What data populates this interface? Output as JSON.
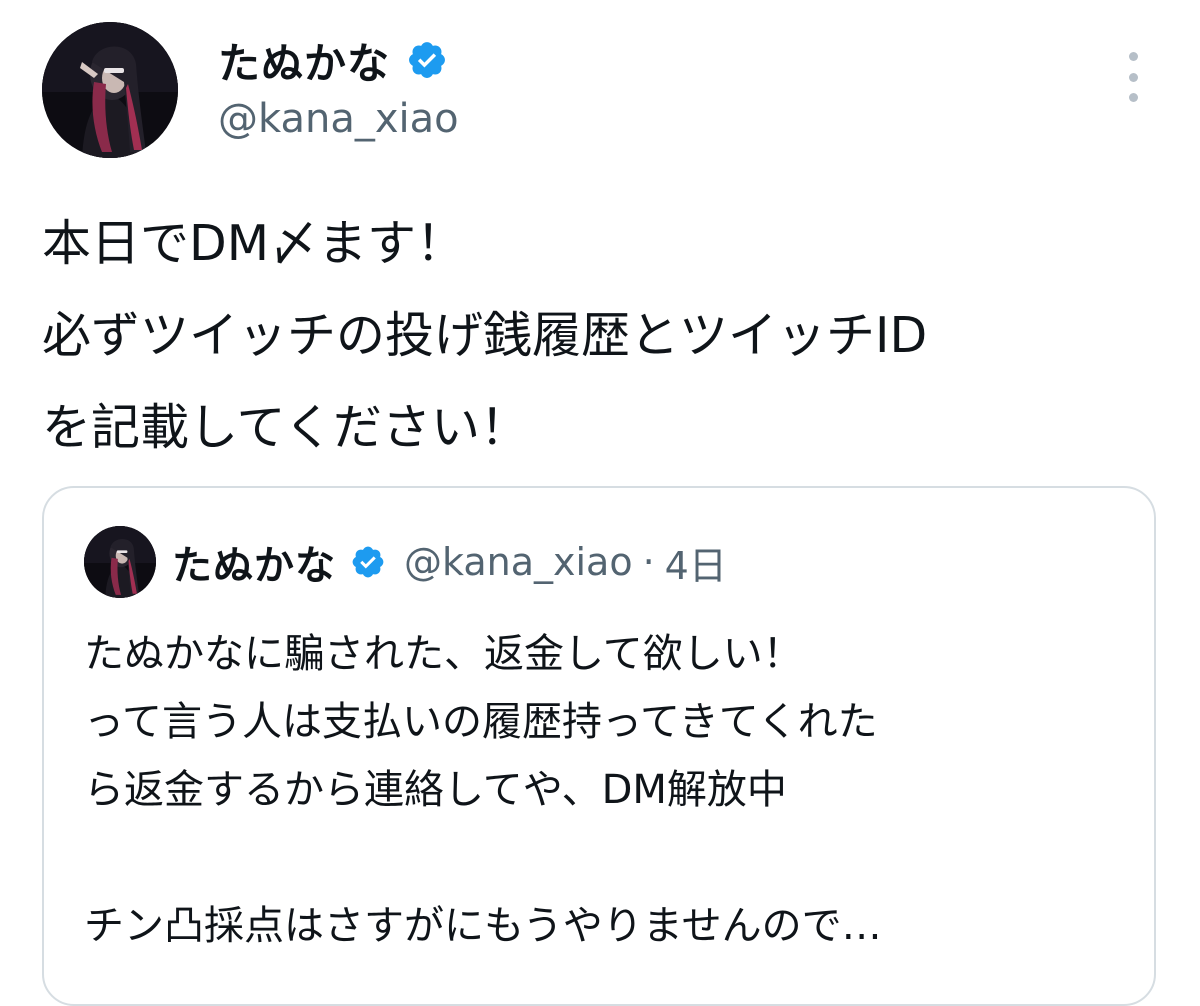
{
  "tweet": {
    "author": {
      "display_name": "たぬかな",
      "handle": "@kana_xiao",
      "verified": true,
      "avatar_icon": "profile-photo"
    },
    "more_icon": "more-vertical-icon",
    "text_lines": [
      "本日でDM〆ます！",
      "必ずツイッチの投げ銭履歴とツイッチID",
      "を記載してください！"
    ],
    "quoted": {
      "author": {
        "display_name": "たぬかな",
        "handle": "@kana_xiao",
        "verified": true
      },
      "separator": "·",
      "time": "4日",
      "text_lines": [
        "たぬかなに騙された、返金して欲しい！",
        "って言う人は支払いの履歴持ってきてくれた",
        "ら返金するから連絡してや、DM解放中",
        "",
        "チン凸採点はさすがにもうやりませんので…"
      ]
    }
  },
  "colors": {
    "text_primary": "#0f1419",
    "text_secondary": "#536471",
    "verified_blue": "#1d9bf0",
    "border": "#d6dde2"
  }
}
